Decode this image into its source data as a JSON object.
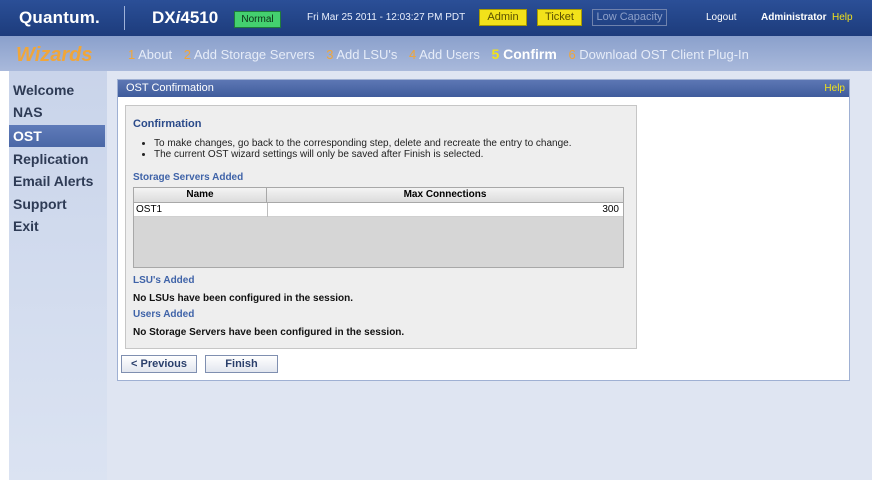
{
  "header": {
    "logo": "Quantum.",
    "product_prefix": "DX",
    "product_italic": "i",
    "product_suffix": "4510",
    "status": "Normal",
    "datetime": "Fri Mar 25 2011 - 12:03:27 PM PDT",
    "badges": {
      "admin": "Admin",
      "ticket": "Ticket",
      "low_capacity": "Low Capacity"
    },
    "logout": "Logout",
    "user": "Administrator",
    "help": "Help"
  },
  "wizard": {
    "title": "Wizards",
    "steps": [
      {
        "num": "1",
        "label": "About"
      },
      {
        "num": "2",
        "label": "Add Storage Servers"
      },
      {
        "num": "3",
        "label": "Add LSU's"
      },
      {
        "num": "4",
        "label": "Add Users"
      },
      {
        "num": "5",
        "label": "Confirm"
      },
      {
        "num": "6",
        "label": "Download OST Client Plug-In"
      }
    ],
    "active_step": 5
  },
  "sidebar": {
    "items": [
      "Welcome",
      "NAS",
      "OST",
      "Replication",
      "Email Alerts",
      "Support",
      "Exit"
    ],
    "active": "OST"
  },
  "panel": {
    "title": "OST Confirmation",
    "help": "Help",
    "confirmation_title": "Confirmation",
    "bullets": [
      "To make changes, go back to the corresponding step, delete and recreate the entry to change.",
      "The current OST wizard settings will only be saved after Finish is selected."
    ],
    "storage_servers_title": "Storage Servers Added",
    "table": {
      "columns": [
        "Name",
        "Max Connections"
      ],
      "rows": [
        [
          "OST1",
          "300"
        ]
      ]
    },
    "lsus_title": "LSU's Added",
    "lsus_text": "No LSUs have been configured in the session.",
    "users_title": "Users Added",
    "users_text": "No Storage Servers have been configured in the session.",
    "buttons": {
      "previous": "< Previous",
      "finish": "Finish"
    }
  },
  "colors": {
    "header_bg": "#1d3c7c",
    "wizard_orange": "#f0a63a",
    "badge_yellow": "#f2e21a",
    "status_green": "#44d06f",
    "nav_active": "#4a67a6"
  }
}
